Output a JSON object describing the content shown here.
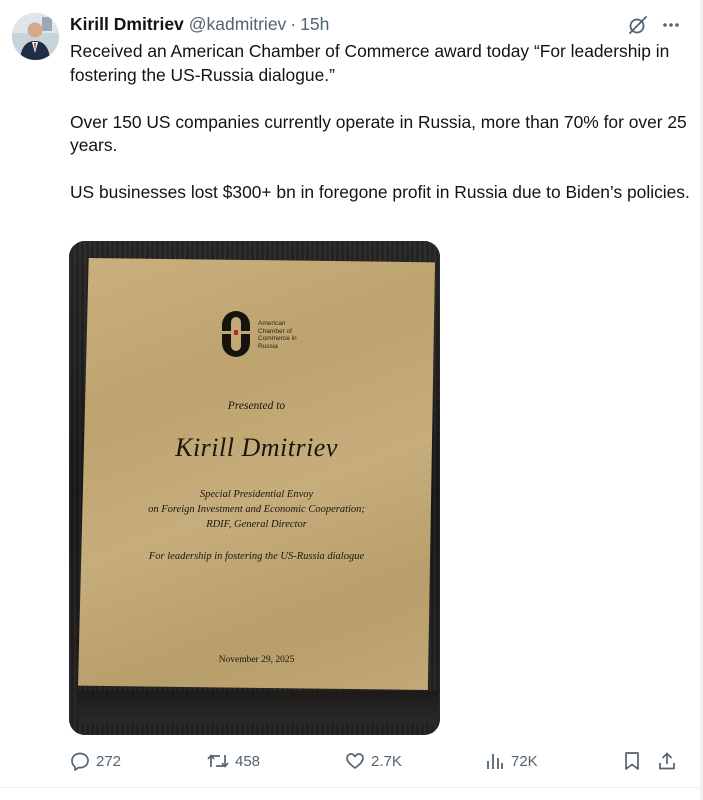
{
  "tweet": {
    "author_name": "Kirill Dmitriev",
    "handle": "@kadmitriev",
    "separator": "·",
    "time": "15h",
    "paragraphs": [
      "Received an American Chamber of Commerce award today “For leadership in fostering the US-Russia dialogue.”",
      "Over 150 US companies currently operate in Russia, more than 70% for over 25 years.",
      "US businesses lost $300+ bn in foregone profit in Russia due to Biden’s policies."
    ]
  },
  "plaque": {
    "org_lines": [
      "American",
      "Chamber of",
      "Commerce in",
      "Russia"
    ],
    "presented_to": "Presented to",
    "recipient": "Kirill Dmitriev",
    "role_lines": [
      "Special Presidential Envoy",
      "on Foreign Investment and Economic Cooperation;",
      "RDIF, General Director"
    ],
    "reason": "For leadership in fostering the US-Russia dialogue",
    "date": "November 29, 2025"
  },
  "actions": {
    "replies": "272",
    "reposts": "458",
    "likes": "2.7K",
    "views": "72K"
  },
  "icons": {
    "grok": "grok-icon",
    "more": "more-icon",
    "reply": "reply-icon",
    "repost": "repost-icon",
    "like": "heart-icon",
    "views": "views-icon",
    "bookmark": "bookmark-icon",
    "share": "share-icon"
  },
  "colors": {
    "text": "#0f1419",
    "secondary": "#536471",
    "plaque_gold": "#c2a977"
  }
}
